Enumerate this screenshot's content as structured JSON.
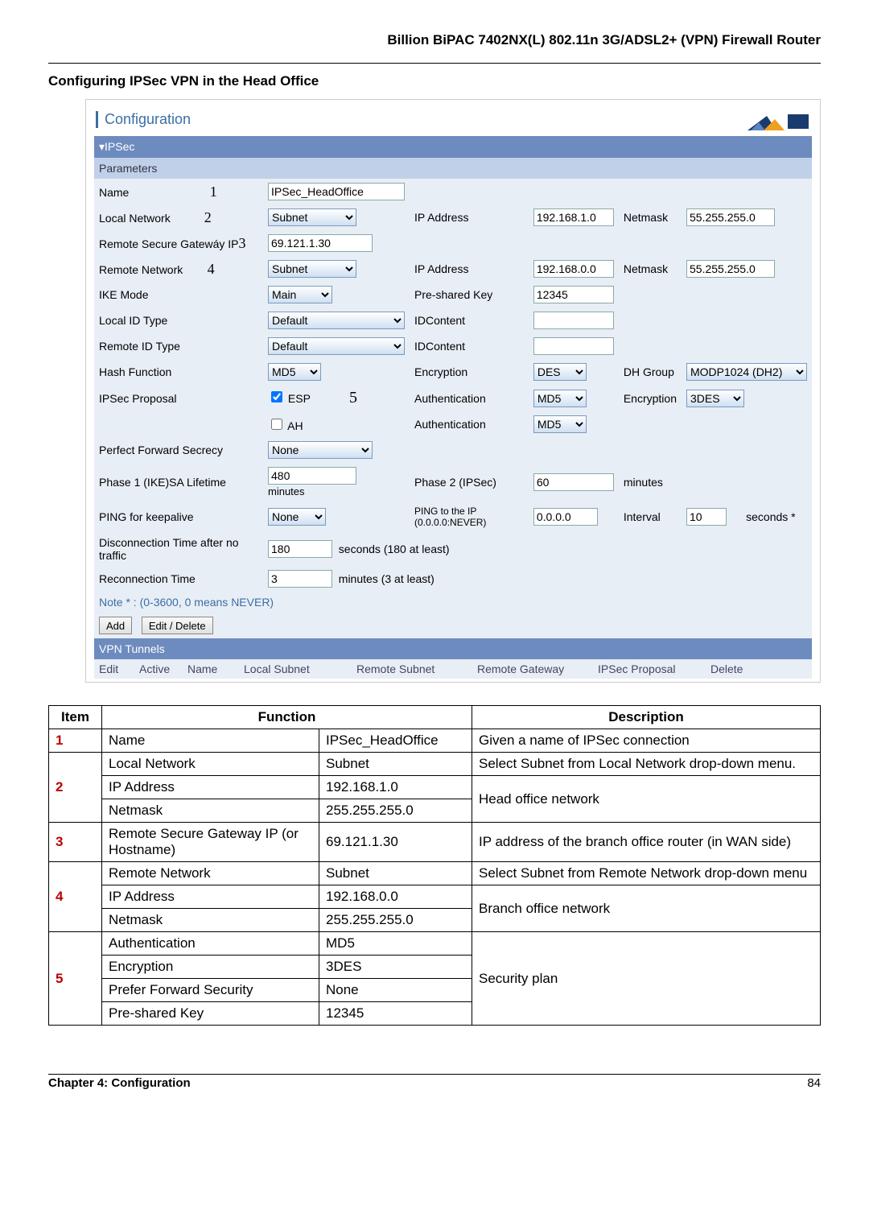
{
  "header": {
    "title": "Billion BiPAC 7402NX(L) 802.11n 3G/ADSL2+ (VPN) Firewall Router"
  },
  "section": {
    "heading": "Configuring IPSec VPN in the Head Office"
  },
  "panel": {
    "title": "Configuration",
    "ipsec_bar": "▾IPSec",
    "parameters_bar": "Parameters",
    "labels": {
      "name": "Name",
      "local_network": "Local Network",
      "remote_gw_ip": "Remote Secure Gatewáy IP",
      "remote_network": "Remote Network",
      "ike_mode": "IKE Mode",
      "local_id_type": "Local ID Type",
      "remote_id_type": "Remote ID Type",
      "hash_function": "Hash Function",
      "ipsec_proposal": "IPSec Proposal",
      "pfs": "Perfect Forward Secrecy",
      "phase1": "Phase 1 (IKE)SA Lifetime",
      "ping_keepalive": "PING for keepalive",
      "disc_time": "Disconnection Time after no traffic",
      "reconn_time": "Reconnection Time",
      "ip_address": "IP Address",
      "netmask": "Netmask",
      "psk": "Pre-shared Key",
      "idcontent": "IDContent",
      "encryption": "Encryption",
      "dh_group": "DH Group",
      "authentication": "Authentication",
      "enc2": "Encryption",
      "phase2": "Phase 2 (IPSec)",
      "ping_to_ip": "PING to the IP (0.0.0.0:NEVER)",
      "interval": "Interval",
      "seconds_star": "seconds *",
      "seconds_least": "seconds (180 at least)",
      "minutes_least": "minutes (3 at least)",
      "minutes": "minutes",
      "esp": "ESP",
      "ah": "AH"
    },
    "nums": {
      "n1": "1",
      "n2": "2",
      "n3": "3",
      "n4": "4",
      "n5": "5"
    },
    "values": {
      "name": "IPSec_HeadOffice",
      "local_net_type": "Subnet",
      "local_ip": "192.168.1.0",
      "local_mask": "55.255.255.0",
      "remote_gw": "69.121.1.30",
      "remote_net_type": "Subnet",
      "remote_ip": "192.168.0.0",
      "remote_mask": "55.255.255.0",
      "ike_mode": "Main",
      "psk": "12345",
      "local_id_type": "Default",
      "remote_id_type": "Default",
      "hash": "MD5",
      "enc": "DES",
      "dh": "MODP1024 (DH2)",
      "auth_esp": "MD5",
      "enc_esp": "3DES",
      "auth_ah": "MD5",
      "pfs": "None",
      "phase1": "480",
      "phase2": "60",
      "ping_mode": "None",
      "ping_ip": "0.0.0.0",
      "ping_interval": "10",
      "disc_time": "180",
      "reconn_time": "3"
    },
    "note": "Note * : (0-3600, 0 means NEVER)",
    "buttons": {
      "add": "Add",
      "edit_delete": "Edit / Delete"
    },
    "tunnels": {
      "bar": "VPN Tunnels",
      "cols": {
        "edit": "Edit",
        "active": "Active",
        "name": "Name",
        "local_subnet": "Local Subnet",
        "remote_subnet": "Remote Subnet",
        "remote_gateway": "Remote Gateway",
        "ipsec_proposal": "IPSec Proposal",
        "delete": "Delete"
      }
    }
  },
  "desc": {
    "headers": {
      "item": "Item",
      "function": "Function",
      "description": "Description"
    },
    "rows": [
      {
        "num": "1",
        "a": "Name",
        "b": "IPSec_HeadOffice",
        "c": "Given a name of IPSec connection"
      },
      {
        "num": "2",
        "sub": [
          {
            "a": "Local Network",
            "b": "Subnet",
            "c": "Select Subnet from Local Network drop-down menu."
          },
          {
            "a": "IP Address",
            "b": "192.168.1.0",
            "c_rowspan": "Head office network"
          },
          {
            "a": "Netmask",
            "b": "255.255.255.0"
          }
        ]
      },
      {
        "num": "3",
        "a": "Remote Secure Gateway IP (or Hostname)",
        "b": "69.121.1.30",
        "c": "IP address of the branch office router (in WAN side)"
      },
      {
        "num": "4",
        "sub": [
          {
            "a": "Remote Network",
            "b": "Subnet",
            "c": "Select Subnet from Remote Network drop-down menu"
          },
          {
            "a": "IP Address",
            "b": "192.168.0.0",
            "c_rowspan": "Branch office network"
          },
          {
            "a": "Netmask",
            "b": "255.255.255.0"
          }
        ]
      },
      {
        "num": "5",
        "sub": [
          {
            "a": "Authentication",
            "b": "MD5",
            "c_rowspan": "Security plan"
          },
          {
            "a": "Encryption",
            "b": "3DES"
          },
          {
            "a": "Prefer Forward Security",
            "b": "None"
          },
          {
            "a": "Pre-shared Key",
            "b": "12345"
          }
        ]
      }
    ]
  },
  "footer": {
    "left": "Chapter 4: Configuration",
    "right": "84"
  },
  "chart_data": null
}
